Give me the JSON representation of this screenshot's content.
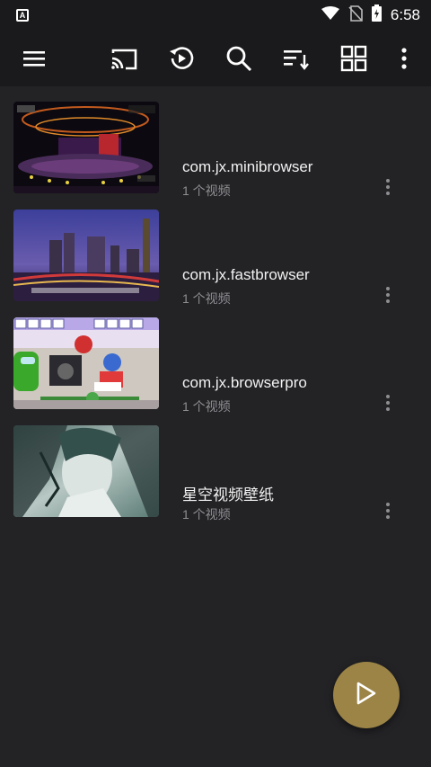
{
  "status_bar": {
    "app_badge": "A",
    "time": "6:58"
  },
  "toolbar": {
    "icons": [
      "menu-icon",
      "cast-icon",
      "history-icon",
      "search-icon",
      "sort-icon",
      "grid-view-icon",
      "more-vert-icon"
    ]
  },
  "folders": [
    {
      "name": "com.jx.minibrowser",
      "count": "1 个视频",
      "thumb": "stage-show"
    },
    {
      "name": "com.jx.fastbrowser",
      "count": "1 个视频",
      "thumb": "city-night"
    },
    {
      "name": "com.jx.browserpro",
      "count": "1 个视频",
      "thumb": "game-cartoon"
    },
    {
      "name": "星空视频壁纸",
      "count": "1 个视频",
      "thumb": "anime-art"
    }
  ],
  "fab": {
    "icon": "play-icon"
  },
  "colors": {
    "background": "#232326",
    "toolbar": "#1a1a1c",
    "fab": "#9c8446",
    "secondary_text": "#8e8e92"
  }
}
